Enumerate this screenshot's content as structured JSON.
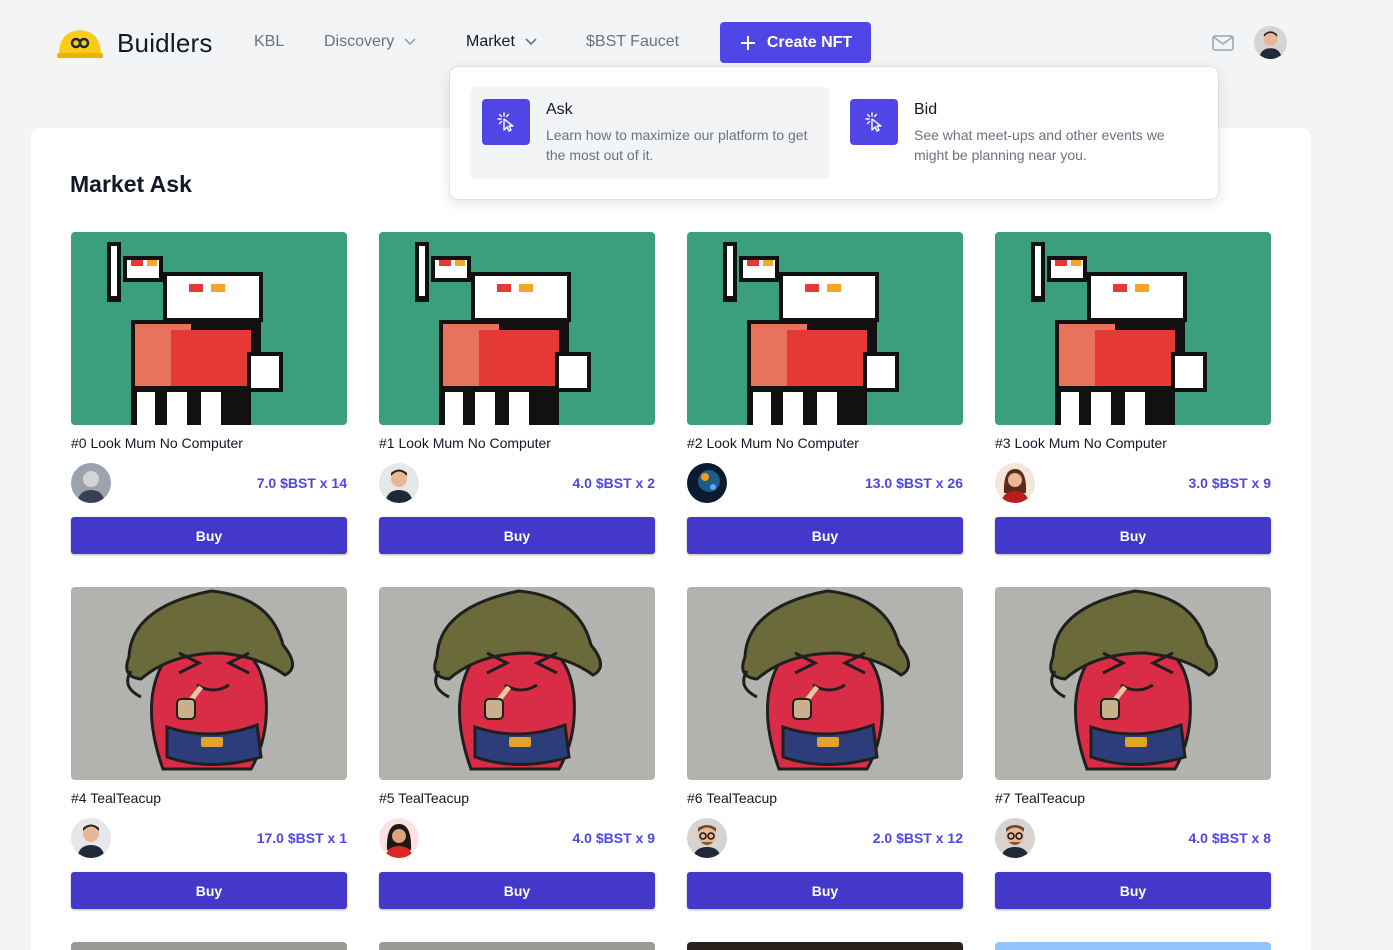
{
  "brand": {
    "name": "Buidlers"
  },
  "nav": {
    "kbl": "KBL",
    "discovery": "Discovery",
    "market": "Market",
    "faucet": "$BST Faucet",
    "create": "Create NFT"
  },
  "dropdown": {
    "ask": {
      "title": "Ask",
      "desc": "Learn how to maximize our platform to get the most out of it."
    },
    "bid": {
      "title": "Bid",
      "desc": "See what meet-ups and other events we might be planning near you."
    }
  },
  "page": {
    "title": "Market Ask"
  },
  "buy_label": "Buy",
  "cards": [
    {
      "name": "#0 Look Mum No Computer",
      "price": "7.0 $BST x 14",
      "art": "pixel",
      "owner": "gray"
    },
    {
      "name": "#1 Look Mum No Computer",
      "price": "4.0 $BST x 2",
      "art": "pixel",
      "owner": "man"
    },
    {
      "name": "#2 Look Mum No Computer",
      "price": "13.0 $BST x 26",
      "art": "pixel",
      "owner": "space"
    },
    {
      "name": "#3 Look Mum No Computer",
      "price": "3.0 $BST x 9",
      "art": "pixel",
      "owner": "woman"
    },
    {
      "name": "#4 TealTeacup",
      "price": "17.0 $BST x 1",
      "art": "bean",
      "owner": "man"
    },
    {
      "name": "#5 TealTeacup",
      "price": "4.0 $BST x 9",
      "art": "bean",
      "owner": "woman2"
    },
    {
      "name": "#6 TealTeacup",
      "price": "2.0 $BST x 12",
      "art": "bean",
      "owner": "glasses"
    },
    {
      "name": "#7 TealTeacup",
      "price": "4.0 $BST x 8",
      "art": "bean",
      "owner": "glasses"
    }
  ],
  "colors": {
    "accent": "#4f46e5",
    "button": "#4338ca"
  }
}
